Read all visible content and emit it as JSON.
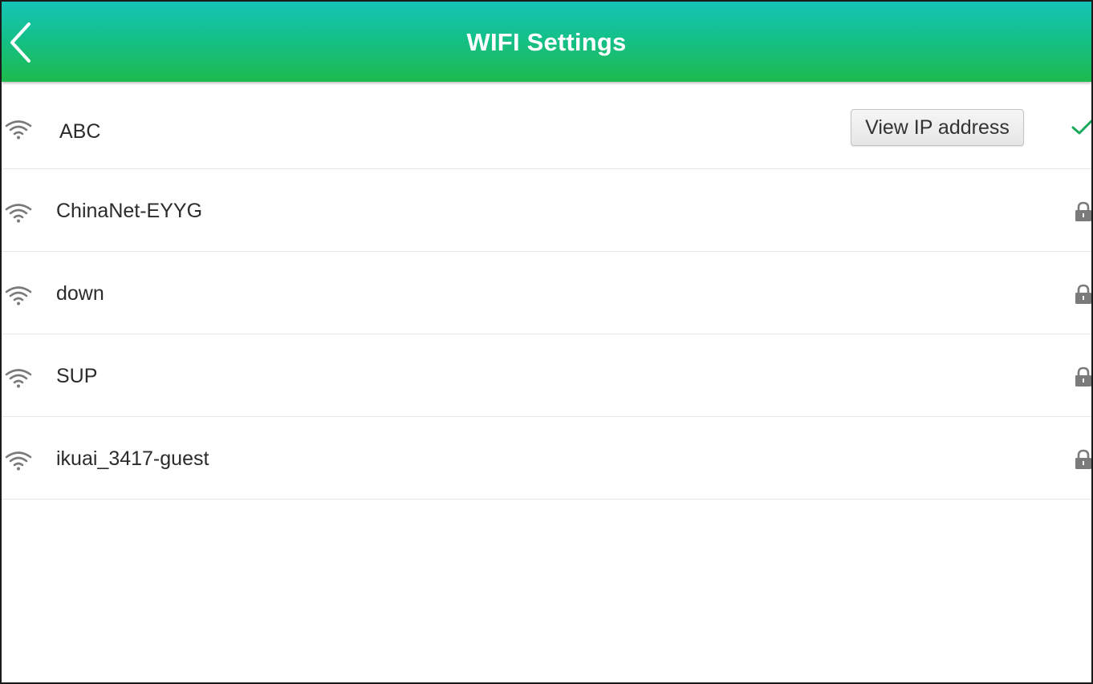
{
  "header": {
    "title": "WIFI Settings",
    "back_icon": "chevron-left-icon"
  },
  "networks": [
    {
      "ssid": "ABC",
      "connected": true,
      "secured": false,
      "action_label": "View IP address",
      "status_icon": "check-icon"
    },
    {
      "ssid": "ChinaNet-EYYG",
      "connected": false,
      "secured": true,
      "status_icon": "lock-icon"
    },
    {
      "ssid": "down",
      "connected": false,
      "secured": true,
      "status_icon": "lock-icon"
    },
    {
      "ssid": "SUP",
      "connected": false,
      "secured": true,
      "status_icon": "lock-icon"
    },
    {
      "ssid": "ikuai_3417-guest",
      "connected": false,
      "secured": true,
      "status_icon": "lock-icon"
    }
  ],
  "colors": {
    "header_top": "#16c4b8",
    "header_bottom": "#1dba4c",
    "check": "#1ba85a",
    "icon_gray": "#7a7a7a"
  }
}
